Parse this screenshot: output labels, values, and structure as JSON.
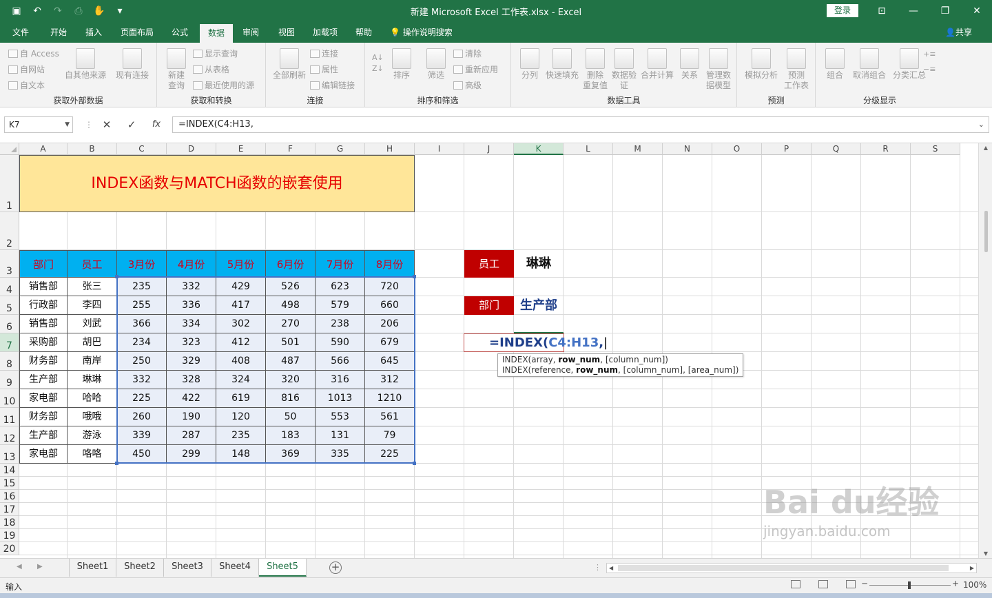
{
  "window": {
    "title": "新建 Microsoft Excel 工作表.xlsx  -  Excel",
    "login_label": "登录"
  },
  "ribbon_tabs": [
    {
      "label": "文件"
    },
    {
      "label": "开始"
    },
    {
      "label": "插入"
    },
    {
      "label": "页面布局"
    },
    {
      "label": "公式"
    },
    {
      "label": "数据"
    },
    {
      "label": "审阅"
    },
    {
      "label": "视图"
    },
    {
      "label": "加载项"
    },
    {
      "label": "帮助"
    },
    {
      "label": "操作说明搜索"
    }
  ],
  "active_tab": "数据",
  "share_label": "共享",
  "ribbon": {
    "groups": [
      {
        "label": "获取外部数据",
        "small": [
          "自 Access",
          "自网站",
          "自文本"
        ],
        "big": [
          "自其他来源",
          "现有连接"
        ]
      },
      {
        "label": "获取和转换",
        "big": [
          "新建\n查询"
        ],
        "small": [
          "显示查询",
          "从表格",
          "最近使用的源"
        ]
      },
      {
        "label": "连接",
        "big": [
          "全部刷新"
        ],
        "small": [
          "连接",
          "属性",
          "编辑链接"
        ]
      },
      {
        "label": "排序和筛选",
        "big": [
          "排序",
          "筛选"
        ],
        "small": [
          "清除",
          "重新应用",
          "高级"
        ]
      },
      {
        "label": "数据工具",
        "big": [
          "分列",
          "快速填充",
          "删除\n重复值",
          "数据验\n证",
          "合并计算",
          "关系",
          "管理数\n据模型"
        ]
      },
      {
        "label": "预测",
        "big": [
          "模拟分析",
          "预测\n工作表"
        ]
      },
      {
        "label": "分级显示",
        "big": [
          "组合",
          "取消组合",
          "分类汇总"
        ]
      }
    ]
  },
  "formula_bar": {
    "name_box": "K7",
    "formula": "=INDEX(C4:H13,",
    "fx": "fx"
  },
  "columns": [
    "A",
    "B",
    "C",
    "D",
    "E",
    "F",
    "G",
    "H",
    "I",
    "J",
    "K",
    "L",
    "M",
    "N",
    "O",
    "P",
    "Q",
    "R",
    "S"
  ],
  "rows": [
    "1",
    "2",
    "3",
    "4",
    "5",
    "6",
    "7",
    "8",
    "9",
    "10",
    "11",
    "12",
    "13",
    "14",
    "15",
    "16",
    "17",
    "18",
    "19",
    "20"
  ],
  "table": {
    "title": "INDEX函数与MATCH函数的嵌套使用",
    "headers": [
      "部门",
      "员工",
      "3月份",
      "4月份",
      "5月份",
      "6月份",
      "7月份",
      "8月份"
    ],
    "rows": [
      [
        "销售部",
        "张三",
        "235",
        "332",
        "429",
        "526",
        "623",
        "720"
      ],
      [
        "行政部",
        "李四",
        "255",
        "336",
        "417",
        "498",
        "579",
        "660"
      ],
      [
        "销售部",
        "刘武",
        "366",
        "334",
        "302",
        "270",
        "238",
        "206"
      ],
      [
        "采购部",
        "胡巴",
        "234",
        "323",
        "412",
        "501",
        "590",
        "679"
      ],
      [
        "财务部",
        "南岸",
        "250",
        "329",
        "408",
        "487",
        "566",
        "645"
      ],
      [
        "生产部",
        "琳琳",
        "332",
        "328",
        "324",
        "320",
        "316",
        "312"
      ],
      [
        "家电部",
        "哈哈",
        "225",
        "422",
        "619",
        "816",
        "1013",
        "1210"
      ],
      [
        "财务部",
        "哦哦",
        "260",
        "190",
        "120",
        "50",
        "553",
        "561"
      ],
      [
        "生产部",
        "游泳",
        "339",
        "287",
        "235",
        "183",
        "131",
        "79"
      ],
      [
        "家电部",
        "咯咯",
        "450",
        "299",
        "148",
        "369",
        "335",
        "225"
      ]
    ]
  },
  "lookup": {
    "employee_label": "员工",
    "employee_value": "琳琳",
    "dept_label": "部门",
    "dept_value": "生产部",
    "edit_prefix": "=INDEX(",
    "edit_ref": "C4:H13",
    "edit_suffix": ","
  },
  "tooltip": {
    "line1_pre": "INDEX(array, ",
    "line1_bold": "row_num",
    "line1_post": ", [column_num])",
    "line2_pre": "INDEX(reference, ",
    "line2_bold": "row_num",
    "line2_post": ", [column_num], [area_num])"
  },
  "sheets": [
    {
      "label": "Sheet1"
    },
    {
      "label": "Sheet2"
    },
    {
      "label": "Sheet3"
    },
    {
      "label": "Sheet4"
    },
    {
      "label": "Sheet5"
    }
  ],
  "active_sheet": "Sheet5",
  "status": {
    "mode": "输入",
    "zoom": "100%"
  },
  "watermark": {
    "brand": "Bai du经验",
    "url": "jingyan.baidu.com"
  },
  "colors": {
    "excel_green": "#217346",
    "title_fill": "#ffe699",
    "title_text": "#e60000",
    "header_fill": "#00b0f0",
    "header_text": "#d0021b",
    "label_fill": "#c00000",
    "ref_blue": "#4472c4"
  }
}
